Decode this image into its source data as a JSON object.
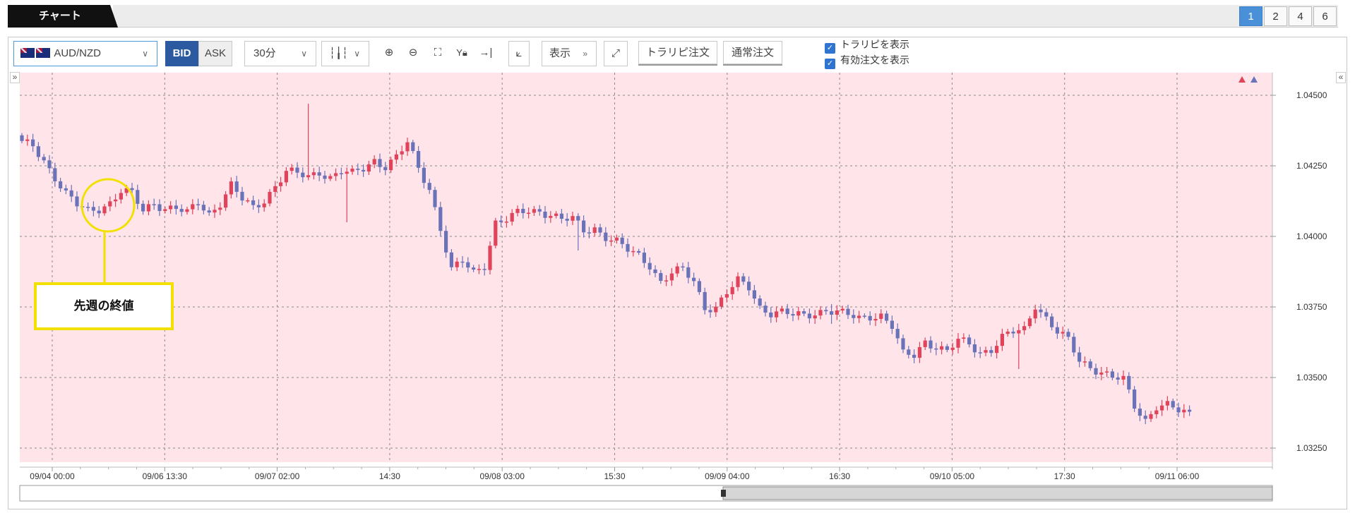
{
  "tabs": {
    "chart_tab": "チャート",
    "pages": [
      "1",
      "2",
      "4",
      "6"
    ],
    "active_page": "1"
  },
  "toolbar": {
    "symbol": "AUD/NZD",
    "bid_label": "BID",
    "ask_label": "ASK",
    "timeframe": "30分",
    "display_label": "表示",
    "tp_sl_order_label": "トラリピ注文",
    "normal_order_label": "通常注文",
    "checkbox_show_trap": "トラリピを表示",
    "checkbox_show_orders": "有効注文を表示",
    "icons": [
      "candlestick-icon",
      "zoom-in-icon",
      "zoom-out-icon",
      "fit-icon",
      "y-axis-lock-icon",
      "jump-to-end-icon",
      "add-indicator-icon",
      "expand-icon"
    ]
  },
  "annotation": {
    "text": "先週の終値",
    "color": "#f2e100"
  },
  "colors": {
    "up": "#e0435a",
    "down": "#6a72b8",
    "background": "#ffe4ea",
    "active_tab": "#4a90d9",
    "bid_button": "#2b5aa0"
  },
  "chart_data": {
    "type": "candlestick",
    "instrument": "AUD/NZD",
    "interval": "30分",
    "ylim": [
      1.032,
      1.0458
    ],
    "yticks": [
      "1.04500",
      "1.04250",
      "1.04000",
      "1.03750",
      "1.03500",
      "1.03250"
    ],
    "xticks": [
      "09/04 00:00",
      "09/06 13:30",
      "09/07 02:00",
      "14:30",
      "09/08 03:00",
      "15:30",
      "09/09 04:00",
      "16:30",
      "09/10 05:00",
      "17:30",
      "09/11 06:00"
    ],
    "grid": true,
    "close_path": [
      [
        0,
        1.0433
      ],
      [
        2,
        1.0432
      ],
      [
        4,
        1.0427
      ],
      [
        6,
        1.0421
      ],
      [
        8,
        1.0415
      ],
      [
        10,
        1.0411
      ],
      [
        12,
        1.0409
      ],
      [
        14,
        1.041
      ],
      [
        16,
        1.0412
      ],
      [
        18,
        1.0416
      ],
      [
        20,
        1.0415
      ],
      [
        22,
        1.0409
      ],
      [
        24,
        1.0412
      ],
      [
        26,
        1.041
      ],
      [
        28,
        1.041
      ],
      [
        30,
        1.0408
      ],
      [
        32,
        1.0412
      ],
      [
        34,
        1.0408
      ],
      [
        36,
        1.0412
      ],
      [
        38,
        1.0418
      ],
      [
        40,
        1.0413
      ],
      [
        42,
        1.041
      ],
      [
        44,
        1.0413
      ],
      [
        46,
        1.0418
      ],
      [
        48,
        1.0423
      ],
      [
        50,
        1.0422
      ],
      [
        52,
        1.0421
      ],
      [
        54,
        1.0423
      ],
      [
        56,
        1.0421
      ],
      [
        58,
        1.0423
      ],
      [
        60,
        1.0422
      ],
      [
        62,
        1.0424
      ],
      [
        64,
        1.0427
      ],
      [
        66,
        1.0425
      ],
      [
        68,
        1.0428
      ],
      [
        70,
        1.0433
      ],
      [
        72,
        1.0424
      ],
      [
        74,
        1.0417
      ],
      [
        76,
        1.0403
      ],
      [
        78,
        1.0388
      ],
      [
        80,
        1.0391
      ],
      [
        82,
        1.0387
      ],
      [
        84,
        1.039
      ],
      [
        86,
        1.0405
      ],
      [
        88,
        1.0406
      ],
      [
        90,
        1.0408
      ],
      [
        92,
        1.0409
      ],
      [
        94,
        1.0409
      ],
      [
        96,
        1.0408
      ],
      [
        98,
        1.0406
      ],
      [
        100,
        1.0406
      ],
      [
        102,
        1.0402
      ],
      [
        104,
        1.0403
      ],
      [
        106,
        1.04
      ],
      [
        108,
        1.0398
      ],
      [
        110,
        1.0395
      ],
      [
        112,
        1.0393
      ],
      [
        114,
        1.039
      ],
      [
        116,
        1.0384
      ],
      [
        118,
        1.0387
      ],
      [
        120,
        1.0388
      ],
      [
        122,
        1.0384
      ],
      [
        124,
        1.0375
      ],
      [
        126,
        1.0375
      ],
      [
        128,
        1.038
      ],
      [
        130,
        1.0384
      ],
      [
        132,
        1.0382
      ],
      [
        134,
        1.0375
      ],
      [
        136,
        1.0373
      ],
      [
        138,
        1.0373
      ],
      [
        140,
        1.0372
      ],
      [
        142,
        1.0372
      ],
      [
        144,
        1.0373
      ],
      [
        146,
        1.0374
      ],
      [
        148,
        1.0373
      ],
      [
        150,
        1.0372
      ],
      [
        152,
        1.0371
      ],
      [
        154,
        1.0372
      ],
      [
        156,
        1.0372
      ],
      [
        158,
        1.0368
      ],
      [
        160,
        1.0358
      ],
      [
        162,
        1.0358
      ],
      [
        164,
        1.0363
      ],
      [
        166,
        1.0361
      ],
      [
        168,
        1.0359
      ],
      [
        170,
        1.0363
      ],
      [
        172,
        1.0362
      ],
      [
        174,
        1.0359
      ],
      [
        176,
        1.036
      ],
      [
        178,
        1.0364
      ],
      [
        180,
        1.0366
      ],
      [
        182,
        1.0367
      ],
      [
        184,
        1.0376
      ],
      [
        186,
        1.0371
      ],
      [
        188,
        1.0366
      ],
      [
        190,
        1.0363
      ],
      [
        192,
        1.0356
      ],
      [
        194,
        1.0354
      ],
      [
        196,
        1.0352
      ],
      [
        198,
        1.035
      ],
      [
        200,
        1.0349
      ],
      [
        202,
        1.034
      ],
      [
        204,
        1.0335
      ],
      [
        206,
        1.034
      ],
      [
        208,
        1.034
      ],
      [
        210,
        1.0338
      ],
      [
        212,
        1.0337
      ]
    ],
    "spikes": [
      [
        101,
        1.0405,
        1.0395
      ],
      [
        59,
        1.0424,
        1.0405
      ],
      [
        52,
        1.0447,
        1.0422
      ],
      [
        147,
        1.0376,
        1.0369
      ],
      [
        181,
        1.0369,
        1.0353
      ]
    ],
    "marked_point": {
      "index": 15,
      "label": "先週の終値"
    }
  }
}
